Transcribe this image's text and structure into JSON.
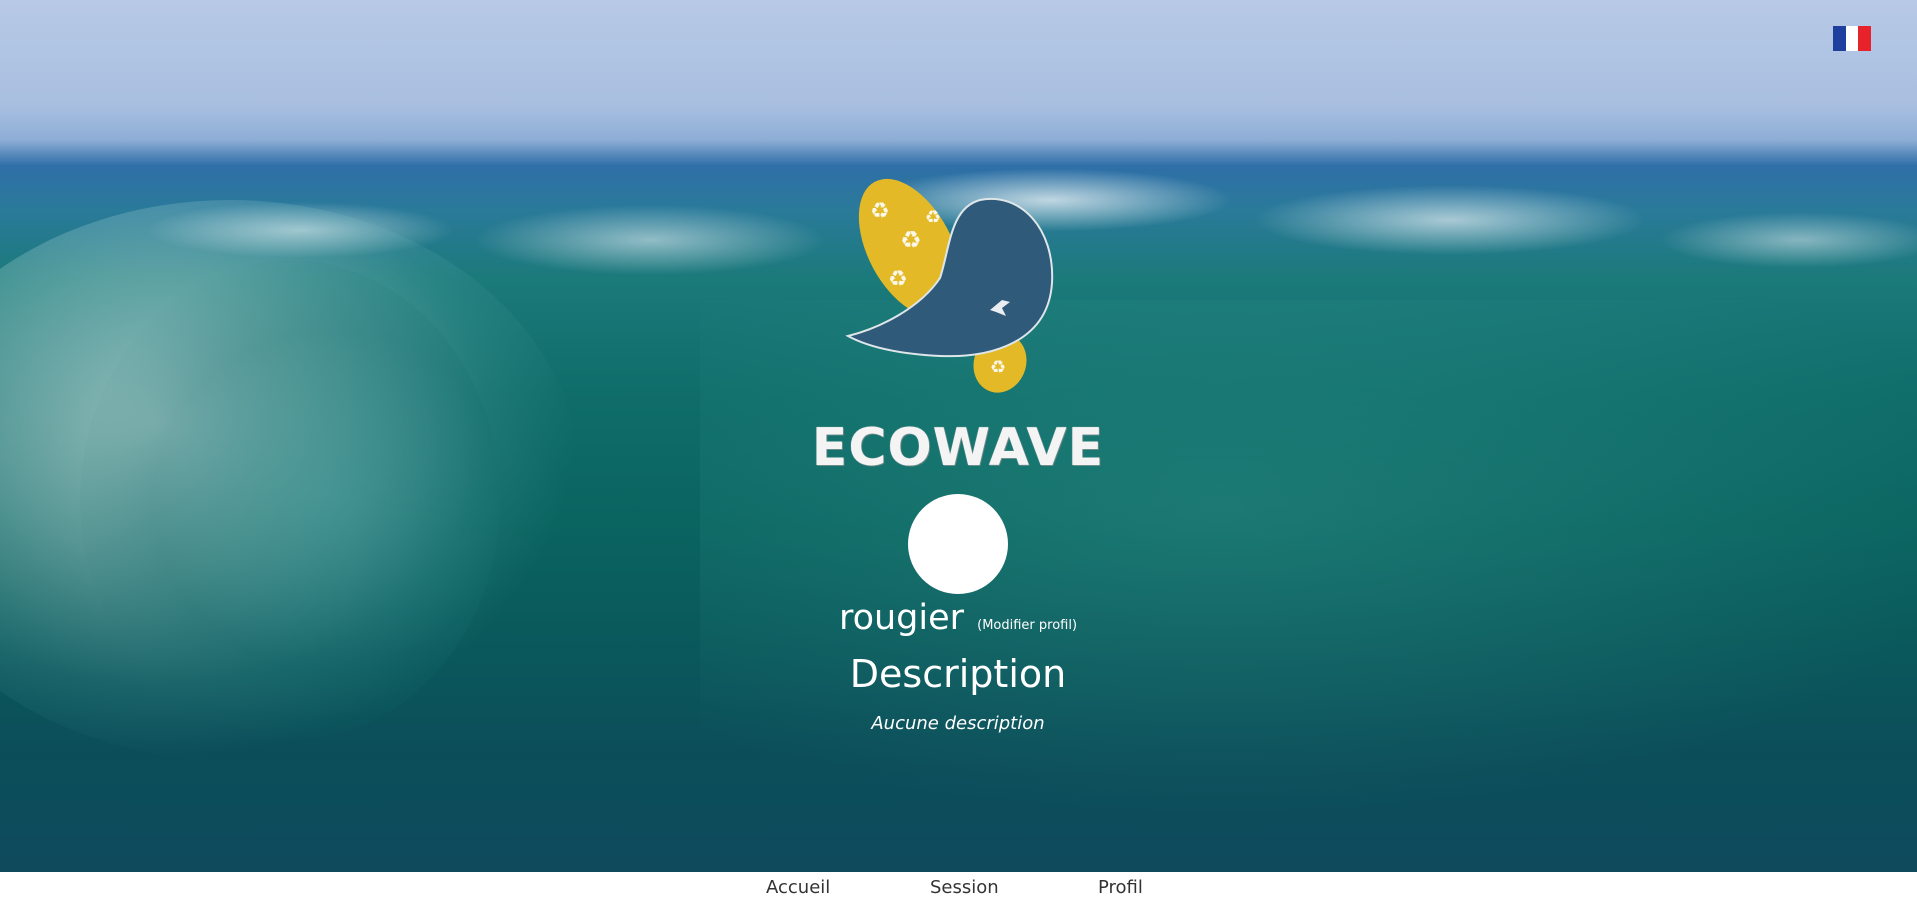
{
  "brand": {
    "name": "ECOWAVE"
  },
  "language": {
    "current": "fr",
    "icon": "french-flag-icon",
    "colors": [
      "#1f3f9e",
      "#ffffff",
      "#e8222b"
    ]
  },
  "profile": {
    "username": "rougier",
    "edit_link": "(Modifier profil)",
    "description_title": "Description",
    "description_text": "Aucune description"
  },
  "nav": {
    "items": [
      {
        "label": "Accueil"
      },
      {
        "label": "Session"
      },
      {
        "label": "Profil"
      }
    ]
  },
  "colors": {
    "logo_yellow": "#e3b927",
    "logo_navy": "#2f5a7a",
    "text_white": "#ffffff"
  }
}
